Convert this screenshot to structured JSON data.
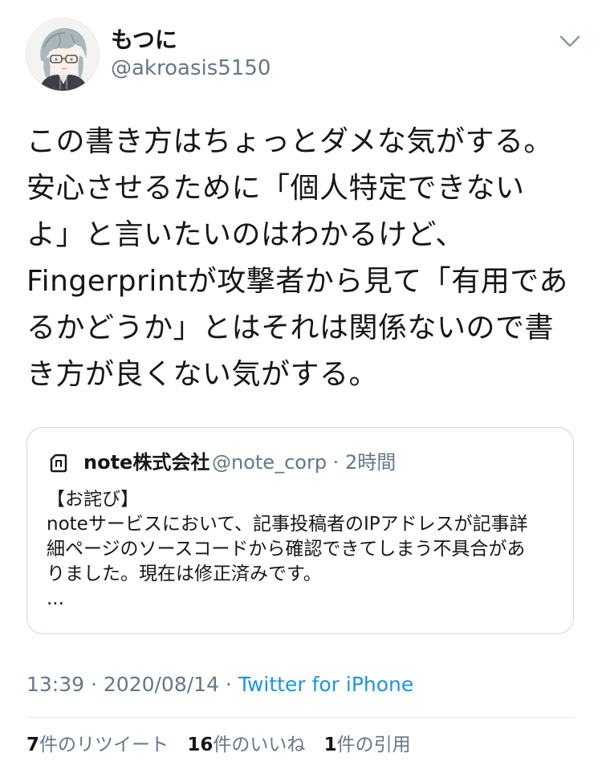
{
  "author": {
    "display_name": "もつに",
    "handle": "@akroasis5150",
    "avatar_icon": "anime-character-avatar-icon"
  },
  "tweet": {
    "lines": [
      "この書き方はちょっとダメな気がする。",
      "安心させるために「個人特定できない",
      "よ」と言いたいのはわかるけど、",
      "Fingerprintが攻撃者から見て「有用であ",
      "るかどうか」とはそれは関係ないので書",
      "き方が良くない気がする。"
    ]
  },
  "quoted_tweet": {
    "name": "note株式会社",
    "handle_time": "@note_corp · 2時間",
    "lines": [
      "【お詫び】",
      "noteサービスにおいて、記事投稿者のIPアドレスが記事詳",
      "細ページのソースコードから確認できてしまう不具合があ",
      "りました。現在は修正済みです。",
      "..."
    ]
  },
  "meta": {
    "timestamp": "13:39 · 2020/08/14 · ",
    "source": "Twitter for iPhone"
  },
  "stats": {
    "retweets_num": "7",
    "retweets_label": "件のリツイート",
    "likes_num": "16",
    "likes_label": "件のいいね",
    "quotes_num": "1",
    "quotes_label": "件の引用"
  },
  "colors": {
    "link": "#1b95e0",
    "secondary_text": "#657786",
    "primary_text": "#14171a",
    "border": "#ccd6dd"
  }
}
